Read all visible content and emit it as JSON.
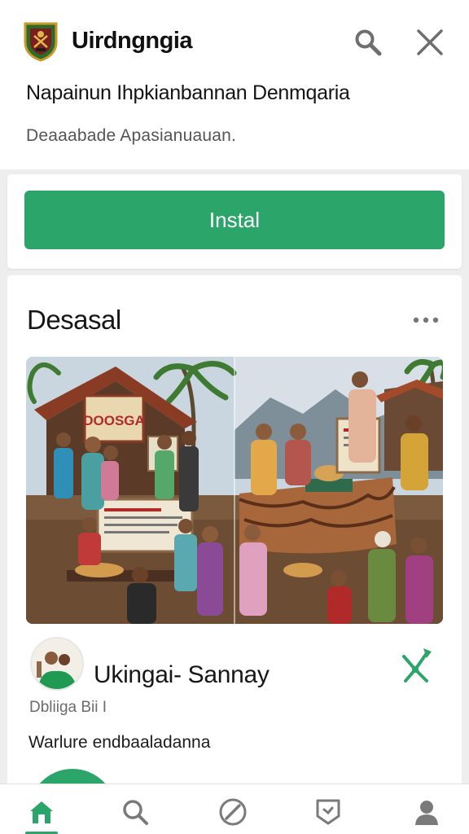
{
  "header": {
    "app_name": "Uirdngngia",
    "subtitle": "Napainun Ihpkianbannan Denmqaria",
    "description": "Deaaabade Apasianuauan.",
    "logo_icon": "crest-logo-icon",
    "search_icon": "search-icon",
    "close_icon": "close-icon"
  },
  "install": {
    "button_label": "Instal",
    "button_color": "#2ba569"
  },
  "post": {
    "title": "Desasal",
    "more_icon": "more-horizontal-icon",
    "image_signs": {
      "left_banner": "DOOSGA"
    },
    "author": {
      "name": "Ukingai- Sannay",
      "meta": "Dbliiga Bii I",
      "share_icon": "share-network-icon"
    },
    "caption": "Warlure endbaaladanna"
  },
  "bottom_nav": {
    "items": [
      {
        "icon": "home-icon",
        "active": true
      },
      {
        "icon": "search-icon",
        "active": false
      },
      {
        "icon": "explore-compass-icon",
        "active": false
      },
      {
        "icon": "badge-shield-icon",
        "active": false
      },
      {
        "icon": "profile-icon",
        "active": false
      }
    ],
    "accent": "#2ba569"
  }
}
